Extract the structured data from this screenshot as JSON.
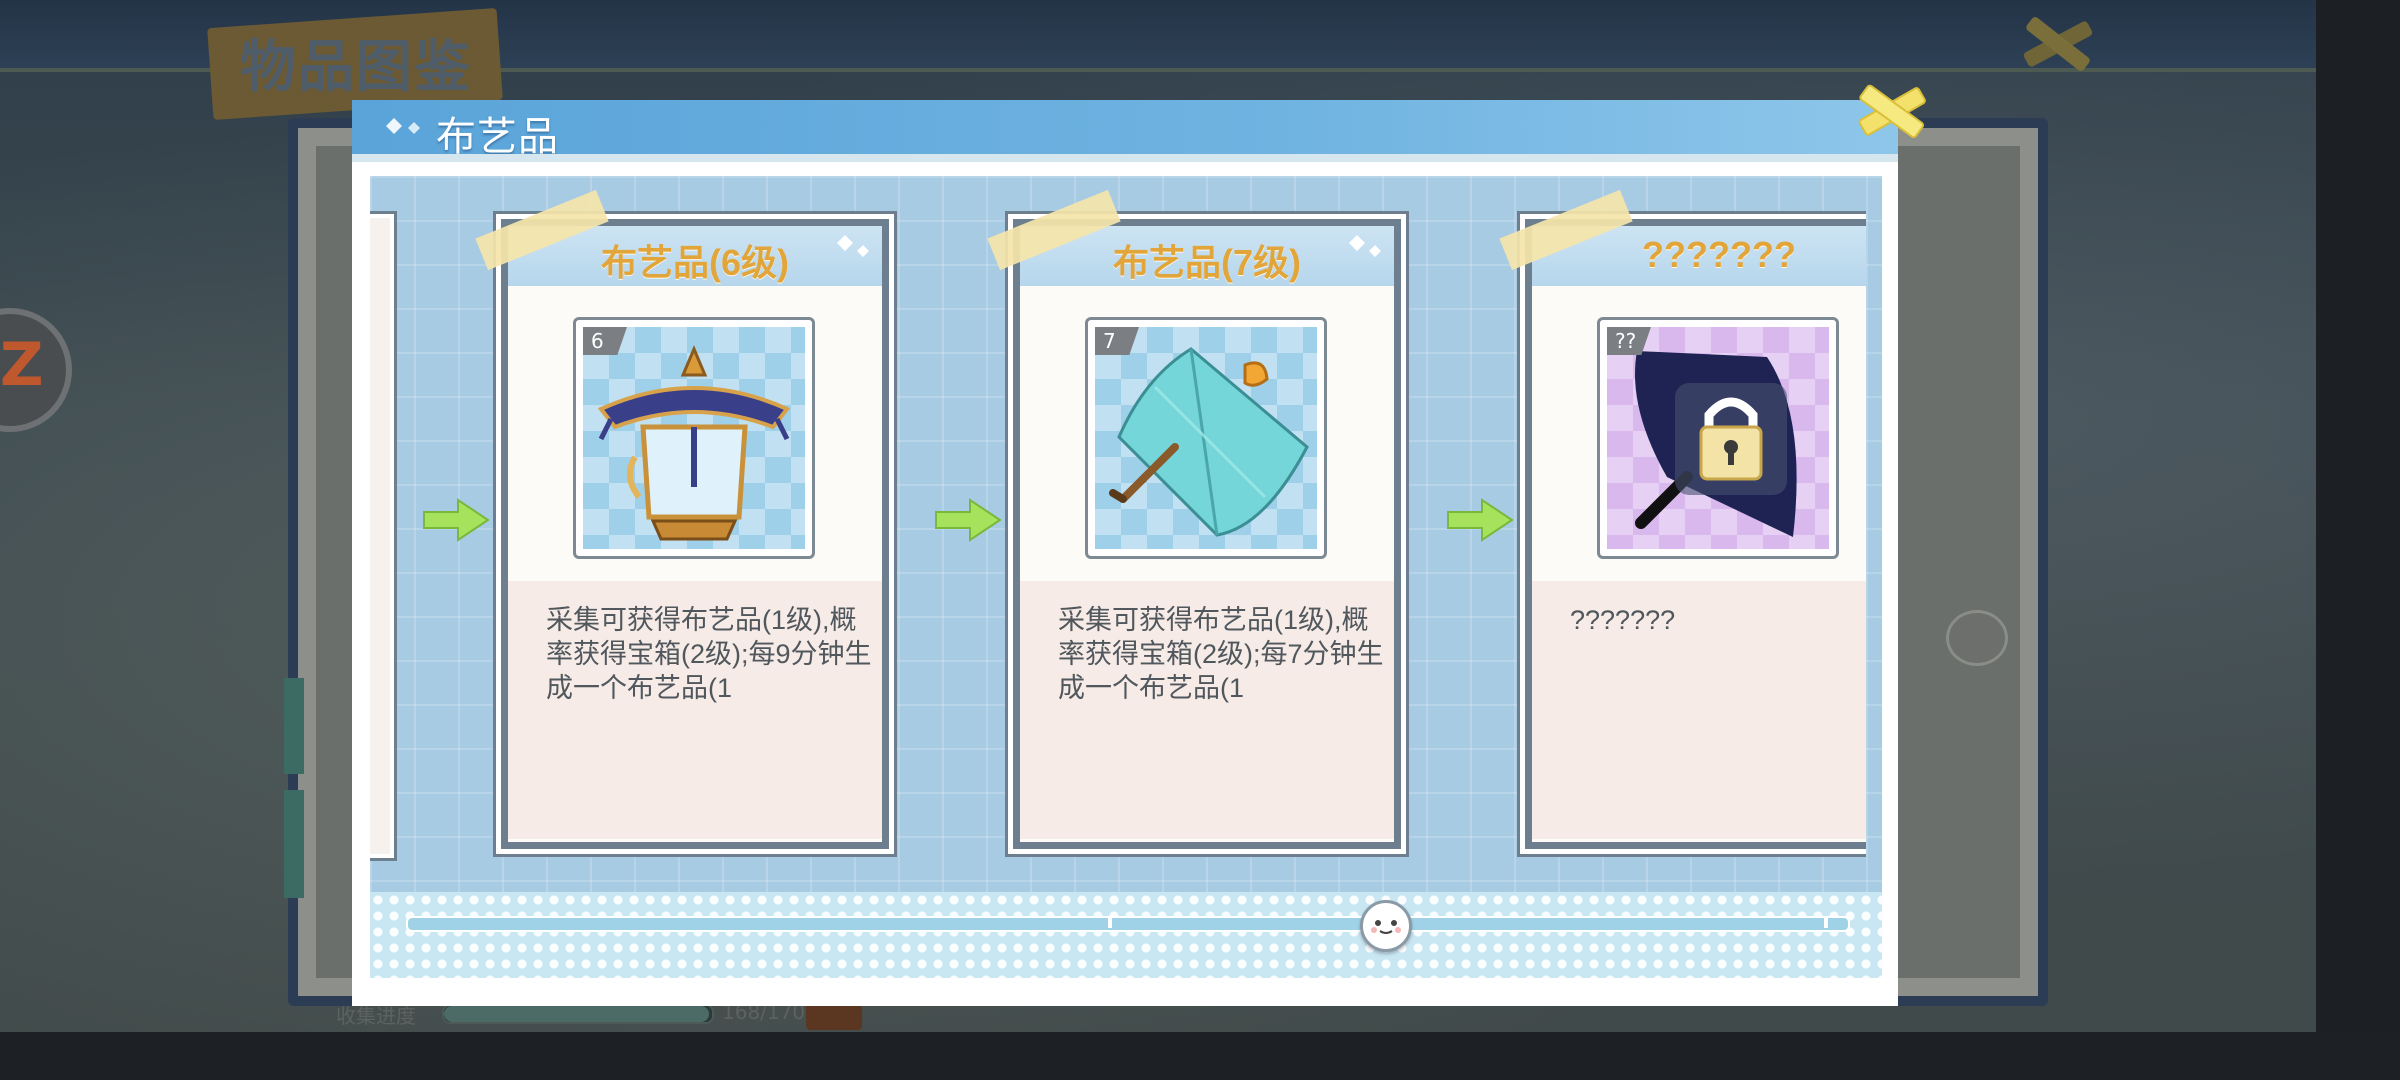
{
  "background": {
    "page_title": "物品图鉴",
    "progress_label": "收集进度",
    "progress_count": "168/170",
    "progress_fraction": 0.988
  },
  "modal": {
    "title": "布艺品",
    "close_icon": "close-cross-icon",
    "cards": [
      {
        "title": "布艺品(6级)",
        "level": "6",
        "item": "lantern",
        "locked": false,
        "description": "采集可获得布艺品(1级),概率获得宝箱(2级);每9分钟生成一个布艺品(1"
      },
      {
        "title": "布艺品(7级)",
        "level": "7",
        "item": "umbrella",
        "locked": false,
        "description": "采集可获得布艺品(1级),概率获得宝箱(2级);每7分钟生成一个布艺品(1"
      },
      {
        "title": "???????",
        "level": "??",
        "item": "dark-umbrella",
        "locked": true,
        "description": "???????"
      }
    ],
    "scrollbar": {
      "thumb_icon": "smiley-face-icon",
      "position_fraction": 0.67
    }
  },
  "colors": {
    "header_blue": "#5aa4d9",
    "card_title_gold": "#e2a53a",
    "arrow_green": "#a6e25c",
    "content_blue": "#a8cbe4"
  }
}
